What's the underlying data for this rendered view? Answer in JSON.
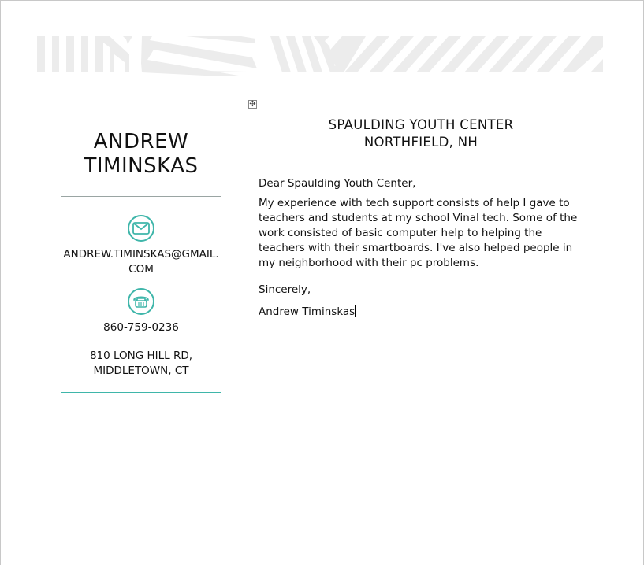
{
  "sender": {
    "name_line1": "ANDREW",
    "name_line2": "TIMINSKAS",
    "email_line1": "ANDREW.TIMINSKAS@GMAIL.",
    "email_line2": "COM",
    "phone": "860-759-0236",
    "address_line1": "810 LONG HILL RD,",
    "address_line2": "MIDDLETOWN, CT",
    "icons": [
      "envelope-icon",
      "telephone-icon"
    ]
  },
  "recipient": {
    "line1": "SPAULDING YOUTH CENTER",
    "line2": "NORTHFIELD, NH"
  },
  "letter": {
    "salutation": "Dear Spaulding Youth Center,",
    "paragraph": "My experience with tech support consists of help I gave to teachers and students at my school Vinal tech. Some of the work consisted of basic computer help to helping the teachers with their smartboards. I've also helped people in my neighborhood with their pc problems.",
    "closing": "Sincerely,",
    "signature": "Andrew Timinskas"
  },
  "colors": {
    "accent": "#3fb6aa",
    "pattern": "#ececec"
  }
}
